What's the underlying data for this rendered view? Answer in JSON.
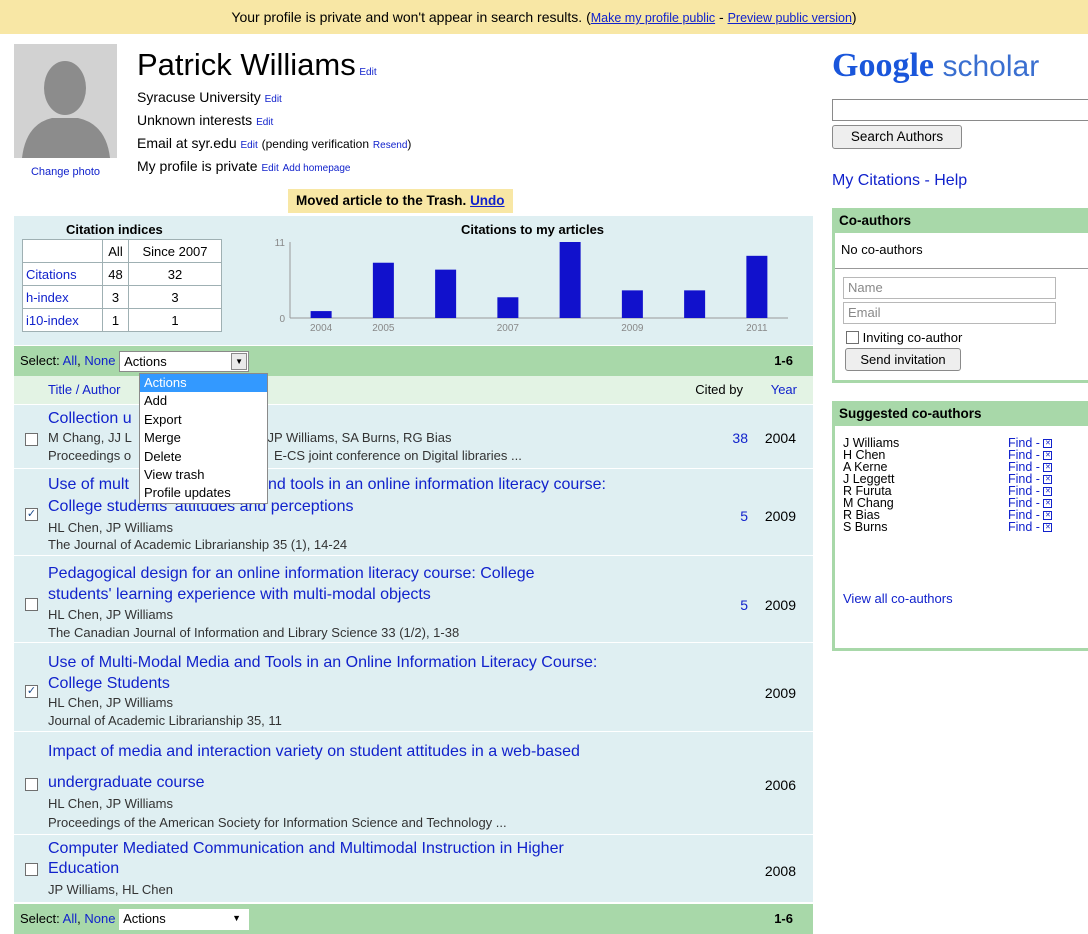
{
  "notice": {
    "text": "Your profile is private and won't appear in search results. (",
    "make_public": "Make my profile public",
    "sep": " - ",
    "preview": "Preview public version",
    "close": ")"
  },
  "profile": {
    "name": "Patrick Williams",
    "edit": "Edit",
    "affiliation": "Syracuse University",
    "interests": "Unknown interests",
    "email": "Email at syr.edu",
    "pending": "(pending verification",
    "resend": "Resend",
    "pending_close": ")",
    "privacy": "My profile is private",
    "add_homepage": "Add homepage",
    "change_photo": "Change photo"
  },
  "moved_msg": {
    "text": "Moved article to the Trash.",
    "undo": "Undo"
  },
  "citation_indices": {
    "title": "Citation indices",
    "headers": [
      "",
      "All",
      "Since 2007"
    ],
    "rows": [
      {
        "label": "Citations",
        "all": "48",
        "since": "32"
      },
      {
        "label": "h-index",
        "all": "3",
        "since": "3"
      },
      {
        "label": "i10-index",
        "all": "1",
        "since": "1"
      }
    ]
  },
  "chart_data": {
    "type": "bar",
    "title": "Citations to my articles",
    "categories": [
      "2004",
      "2005",
      "2006",
      "2007",
      "2008",
      "2009",
      "2010",
      "2011"
    ],
    "values": [
      1,
      8,
      7,
      3,
      11,
      4,
      4,
      9
    ],
    "tick_labels": [
      "2004",
      "2005",
      "2007",
      "2009",
      "2011"
    ],
    "y_ticks": [
      "0",
      "11"
    ],
    "ylim": [
      0,
      11
    ],
    "bar_color": "#1111cc"
  },
  "select_bar": {
    "label": "Select:",
    "all": "All",
    "none": "None",
    "actions": "Actions",
    "count": "1-6"
  },
  "list_header": {
    "title_author": "Title / Author",
    "cited_by": "Cited by",
    "year": "Year"
  },
  "menu": [
    "Actions",
    "Add",
    "Export",
    "Merge",
    "Delete",
    "View trash",
    "Profile updates"
  ],
  "articles": [
    {
      "title": "Collection u",
      "authors": "M Chang, JJ L",
      "authors_tail": "A Kerne, JP Williams, SA Burns, RG Bias",
      "venue": "Proceedings o",
      "venue_tail": "E-CS joint conference on Digital libraries ...",
      "cited": "38",
      "year": "2004",
      "checked": false
    },
    {
      "title_a": "Use of mult",
      "title_b": "nd tools in an online information literacy course:",
      "title_c": "College students' attitudes and perceptions",
      "authors": "HL Chen, JP Williams",
      "venue": "The Journal of Academic Librarianship 35 (1), 14-24",
      "cited": "5",
      "year": "2009",
      "checked": true
    },
    {
      "title_a": "Pedagogical design for an online information literacy course: College",
      "title_b": "students' learning experience with multi-modal objects",
      "authors": "HL Chen, JP Williams",
      "venue": "The Canadian Journal of Information and Library Science 33 (1/2), 1-38",
      "cited": "5",
      "year": "2009",
      "checked": false
    },
    {
      "title_a": "Use of Multi-Modal Media and Tools in an Online Information Literacy Course:",
      "title_b": "College Students",
      "authors": "HL Chen, JP Williams",
      "venue": "Journal of Academic Librarianship 35, 11",
      "cited": "",
      "year": "2009",
      "checked": true
    },
    {
      "title_a": "Impact of media and interaction variety on student attitudes in a web-based",
      "title_b": "undergraduate course",
      "authors": "HL Chen, JP Williams",
      "venue": "Proceedings of the American Society for Information Science and Technology ...",
      "cited": "",
      "year": "2006",
      "checked": false
    },
    {
      "title_a": "Computer Mediated Communication and Multimodal Instruction in Higher",
      "title_b": "Education",
      "authors": "JP Williams, HL Chen",
      "venue": "",
      "cited": "",
      "year": "2008",
      "checked": false
    }
  ],
  "right": {
    "logo_google": "Google",
    "logo_scholar": "scholar",
    "search_button": "Search Authors",
    "my_citations": "My Citations - Help",
    "coauthors_title": "Co-authors",
    "no_coauthors": "No co-authors",
    "name_placeholder": "Name",
    "email_placeholder": "Email",
    "inviting_label": "Inviting co-author",
    "send_invitation": "Send invitation",
    "suggested_title": "Suggested co-authors",
    "suggested": [
      "J Williams",
      "H Chen",
      "A Kerne",
      "J Leggett",
      "R Furuta",
      "M Chang",
      "R Bias",
      "S Burns"
    ],
    "find": "Find - ",
    "view_all": "View all co-authors"
  }
}
